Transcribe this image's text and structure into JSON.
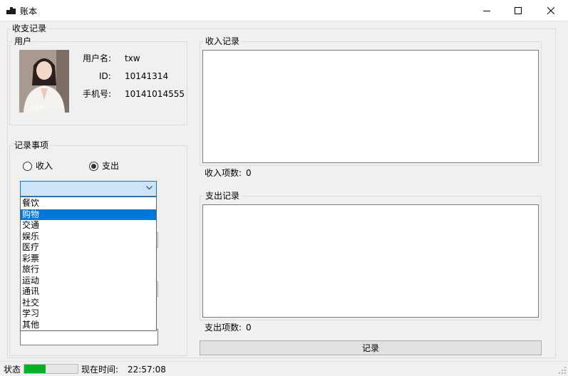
{
  "window": {
    "title": "账本",
    "icon": "app-icon",
    "controls": [
      "minimize-icon",
      "maximize-icon",
      "close-icon"
    ]
  },
  "main_group": {
    "title": "收支记录"
  },
  "user_group": {
    "title": "用户",
    "avatar": "user-photo",
    "username_label": "用户名:",
    "username": "txw",
    "id_label": "ID:",
    "id": "10141314",
    "phone_label": "手机号:",
    "phone": "10141014555"
  },
  "record_group": {
    "title": "记录事项",
    "income_radio": {
      "label": "收入",
      "checked": false
    },
    "expense_radio": {
      "label": "支出",
      "checked": true
    },
    "category_combo": {
      "value": "",
      "options": [
        "餐饮",
        "购物",
        "交通",
        "娱乐",
        "医疗",
        "彩票",
        "旅行",
        "运动",
        "通讯",
        "社交",
        "学习",
        "其他"
      ],
      "highlighted": "购物"
    }
  },
  "income_group": {
    "title": "收入记录",
    "count_label": "收入项数:",
    "count": "0"
  },
  "expense_group": {
    "title": "支出记录",
    "count_label": "支出项数:",
    "count": "0"
  },
  "record_button": {
    "label": "记录"
  },
  "statusbar": {
    "status_label": "状态",
    "progress": 0.4,
    "progress_color": "#06b025",
    "time_label": "现在时间:",
    "time": "22:57:08"
  },
  "colors": {
    "accent": "#0078d7",
    "combo_background": "#cce4f7"
  }
}
